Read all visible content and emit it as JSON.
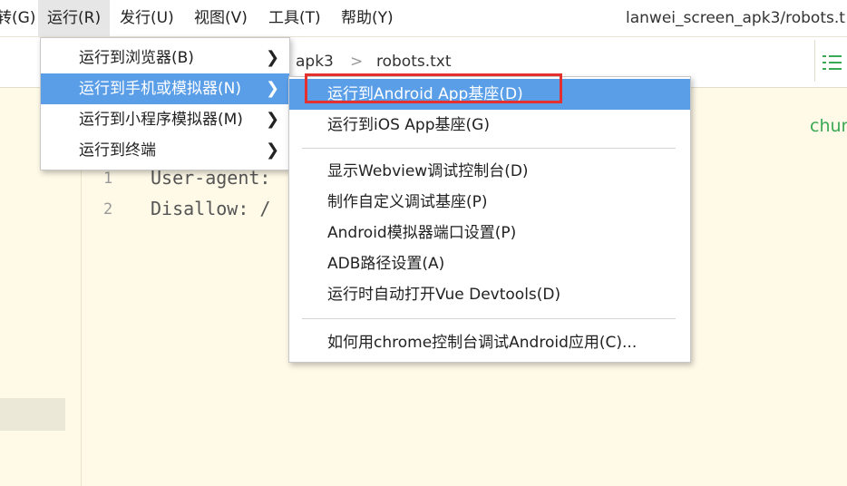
{
  "menubar": {
    "items": [
      {
        "label": "转(G)"
      },
      {
        "label": "运行(R)"
      },
      {
        "label": "发行(U)"
      },
      {
        "label": "视图(V)"
      },
      {
        "label": "工具(T)"
      },
      {
        "label": "帮助(Y)"
      }
    ],
    "window_title": "lanwei_screen_apk3/robots.t"
  },
  "breadcrumb": {
    "project": "apk3",
    "separator": ">",
    "file": "robots.txt"
  },
  "editor": {
    "lines": [
      {
        "number": "1",
        "text": "User-agent:"
      },
      {
        "number": "2",
        "text": "Disallow: /"
      }
    ],
    "hint_text": "chur"
  },
  "run_menu": {
    "items": [
      {
        "label": "运行到浏览器(B)",
        "arrow": "❯"
      },
      {
        "label": "运行到手机或模拟器(N)",
        "arrow": "❯"
      },
      {
        "label": "运行到小程序模拟器(M)",
        "arrow": "❯"
      },
      {
        "label": "运行到终端",
        "arrow": "❯"
      }
    ]
  },
  "device_submenu": {
    "items": [
      {
        "label": "运行到Android App基座(D)"
      },
      {
        "label": "运行到iOS App基座(G)"
      },
      {
        "label": "显示Webview调试控制台(D)"
      },
      {
        "label": "制作自定义调试基座(P)"
      },
      {
        "label": "Android模拟器端口设置(P)"
      },
      {
        "label": "ADB路径设置(A)"
      },
      {
        "label": "运行时自动打开Vue Devtools(D)"
      },
      {
        "label": "如何用chrome控制台调试Android应用(C)..."
      }
    ]
  },
  "colors": {
    "highlight": "#5b9ee8",
    "annotation_box": "#e53030",
    "editor_bg": "#fffae8",
    "hint_green": "#3aa956"
  }
}
